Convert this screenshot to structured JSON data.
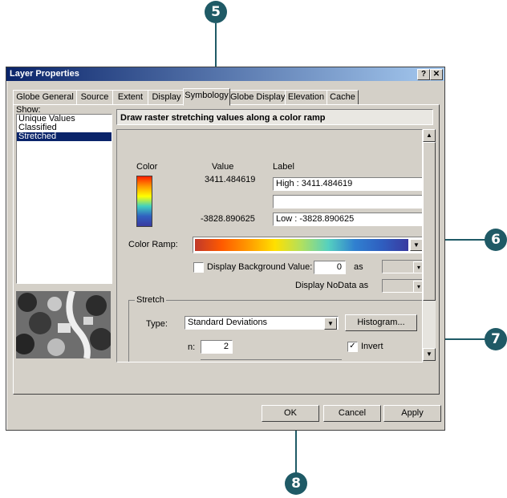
{
  "window": {
    "title": "Layer Properties",
    "help_btn": "?",
    "close_btn": "✕"
  },
  "tabs": [
    "Globe General",
    "Source",
    "Extent",
    "Display",
    "Symbology",
    "Globe Display",
    "Elevation",
    "Cache"
  ],
  "show_label": "Show:",
  "show_list": [
    "Unique Values",
    "Classified",
    "Stretched"
  ],
  "panel": {
    "header": "Draw raster stretching values along a color ramp",
    "color_col": "Color",
    "value_col": "Value",
    "label_col": "Label",
    "high_value": "3411.484619",
    "high_label": "High : 3411.484619",
    "mid_label": "",
    "low_value": "-3828.890625",
    "low_label": "Low : -3828.890625",
    "color_ramp_label": "Color Ramp:",
    "bg_value_label": "Display Background Value:",
    "bg_value": "0",
    "as_label": "as",
    "nodata_label": "Display NoData as",
    "stretch_label": "Stretch",
    "type_label": "Type:",
    "type_value": "Standard Deviations",
    "histogram_btn": "Histogram...",
    "n_label": "n:",
    "n_value": "2",
    "invert_label": "Invert",
    "invert_checked": "✓"
  },
  "buttons": {
    "ok": "OK",
    "cancel": "Cancel",
    "apply": "Apply"
  },
  "callouts": [
    "5",
    "6",
    "7",
    "8"
  ],
  "colors": {
    "titlebar": "#0a246a",
    "callout": "#1f5a66",
    "ramp": [
      "#c0392b",
      "#ff8c00",
      "#ffff00",
      "#55d0c0",
      "#2f5fc0",
      "#3a3aa0"
    ]
  }
}
